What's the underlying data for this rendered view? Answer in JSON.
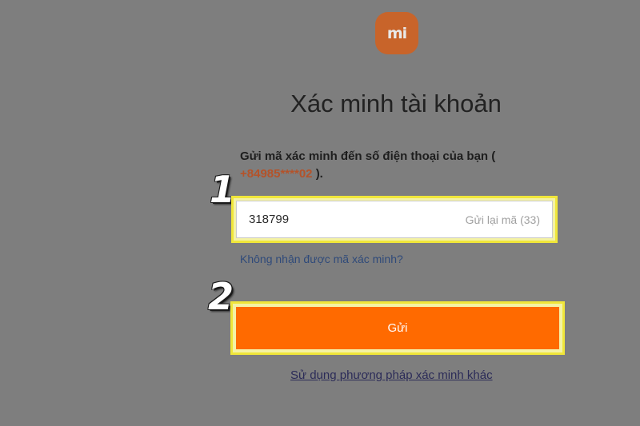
{
  "logo": {
    "text": "mi"
  },
  "page": {
    "title": "Xác minh tài khoản",
    "instruction_prefix": "Gửi mã xác minh đến số điện thoại của bạn (",
    "phone": "+84985****02",
    "instruction_suffix": ").",
    "no_code_link": "Không nhận được mã xác minh?",
    "other_method_link": "Sử dụng phương pháp xác minh khác"
  },
  "code_input": {
    "value": "318799",
    "resend_label": "Gửi lại mã (33)"
  },
  "send_button": {
    "label": "Gửi"
  },
  "markers": {
    "step1": "1",
    "step2": "2"
  },
  "colors": {
    "accent": "#ff6a00",
    "logo_bg": "#c8642a",
    "highlight": "#f0e63a",
    "backdrop": "#7e7e7e"
  }
}
